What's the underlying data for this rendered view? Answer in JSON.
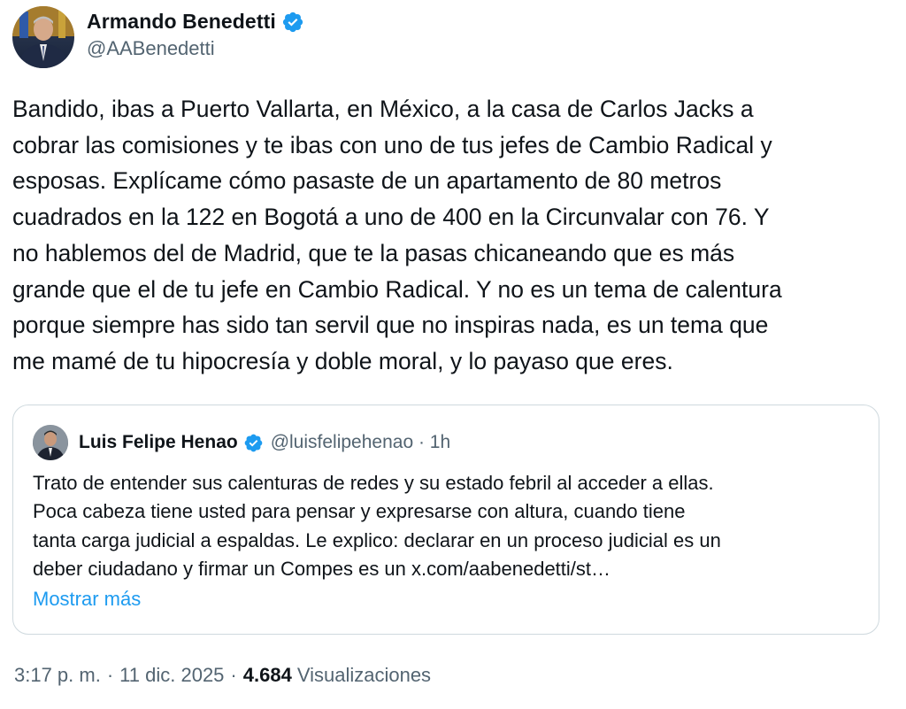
{
  "tweet": {
    "author_name": "Armando Benedetti",
    "author_handle": "@AABenedetti",
    "verified_icon": "verified-badge-icon",
    "text": "Bandido, ibas a Puerto Vallarta, en México, a la casa de Carlos Jacks a\ncobrar las comisiones y te ibas con uno de tus jefes de Cambio Radical y\nesposas. Explícame cómo pasaste de un apartamento de 80 metros\ncuadrados en la 122 en Bogotá a uno de 400 en la Circunvalar con 76. Y\nno hablemos del de Madrid, que te la pasas chicaneando que es más\ngrande que el de tu jefe en Cambio Radical. Y no es un tema de calentura\nporque siempre has sido tan servil que no inspiras nada, es un tema que\nme mamé de tu hipocresía y doble moral, y lo payaso que eres.",
    "time": "3:17 p. m.",
    "date": "11 dic. 2025",
    "views_count": "4.684",
    "views_label": "Visualizaciones",
    "separator": "·"
  },
  "quoted": {
    "author_name": "Luis Felipe Henao",
    "author_handle": "@luisfelipehenao · 1h",
    "text": "Trato de entender sus calenturas de redes y su estado febril al acceder a ellas.\nPoca cabeza tiene usted para pensar y expresarse con altura, cuando tiene\ntanta carga judicial a espaldas. Le explico: declarar en un proceso judicial es un\ndeber ciudadano y firmar un Compes es un x.com/aabenedetti/st…",
    "show_more": "Mostrar más"
  },
  "colors": {
    "text": "#0f1419",
    "secondary": "#536471",
    "link": "#1d9bf0",
    "border": "#cfd9de",
    "verified": "#1d9bf0"
  }
}
